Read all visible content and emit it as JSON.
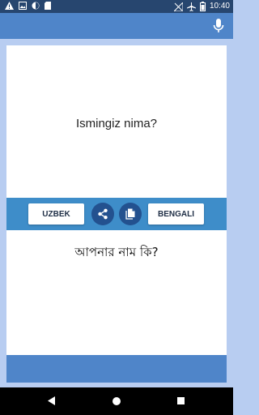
{
  "status_bar": {
    "time": "10:40",
    "left_icons": [
      "warning-icon",
      "photo-icon",
      "circle-icon",
      "sd-card-icon"
    ],
    "right_icons": [
      "no-signal-icon",
      "airplane-icon",
      "battery-icon"
    ]
  },
  "app_bar": {
    "mic_icon": "mic-icon"
  },
  "translation": {
    "source_text": "Ismingiz nima?",
    "target_text": "আপনার নাম কি?"
  },
  "language_bar": {
    "source_language": "UZBEK",
    "target_language": "BENGALI",
    "share_icon": "share-icon",
    "copy_icon": "copy-icon"
  },
  "colors": {
    "status_bar": "#27466f",
    "app_bar": "#4f85c9",
    "background": "#b8cdf1",
    "language_bar": "#3e8dc9",
    "circle_button": "#23518f",
    "footer_bar": "#4f85c9"
  },
  "nav_bar": {
    "icons": [
      "back-icon",
      "home-icon",
      "recents-icon"
    ]
  }
}
